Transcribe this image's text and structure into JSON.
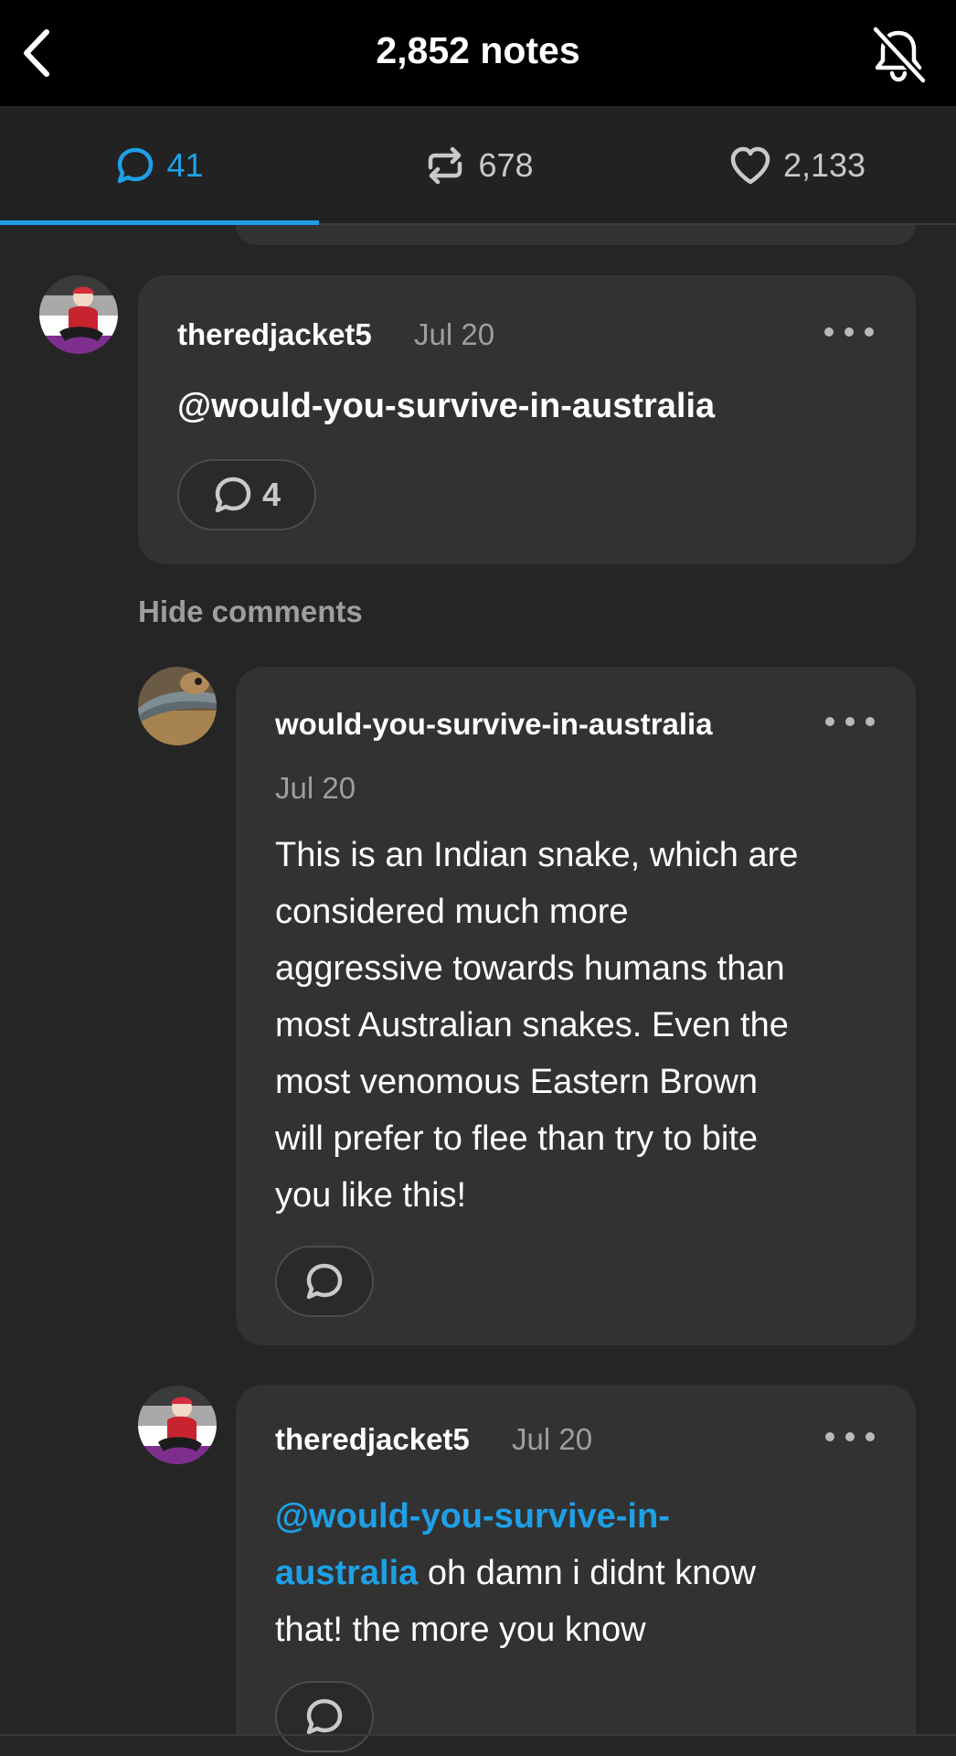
{
  "header": {
    "title": "2,852 notes",
    "back_icon": "chevron-left-icon",
    "mute_icon": "bell-off-icon"
  },
  "tabs": {
    "replies": {
      "count": "41",
      "icon": "speech-bubble-icon"
    },
    "reblogs": {
      "count": "678",
      "icon": "reblog-icon"
    },
    "likes": {
      "count": "2,133",
      "icon": "heart-icon"
    }
  },
  "colors": {
    "accent": "#1ea0e6",
    "background": "#252525",
    "card": "#323232",
    "muted_text": "#9e9e9e"
  },
  "comments": [
    {
      "username": "theredjacket5",
      "date": "Jul 20",
      "mention": "@would-you-survive-in-australia",
      "reply_count": "4"
    }
  ],
  "hide_comments_label": "Hide comments",
  "replies": [
    {
      "username": "would-you-survive-in-australia",
      "date": "Jul 20",
      "lines": [
        "This is an Indian snake, which are",
        "considered much more",
        "aggressive towards humans than",
        "most Australian snakes. Even the",
        "most venomous Eastern Brown",
        "will prefer to flee than try to bite",
        "you like this!"
      ]
    },
    {
      "username": "theredjacket5",
      "date": "Jul 20",
      "mention_line1": "@would-you-survive-in-",
      "mention_line2": "australia",
      "text_line2": " oh damn i didnt know",
      "text_line3": "that! the more you know"
    }
  ]
}
